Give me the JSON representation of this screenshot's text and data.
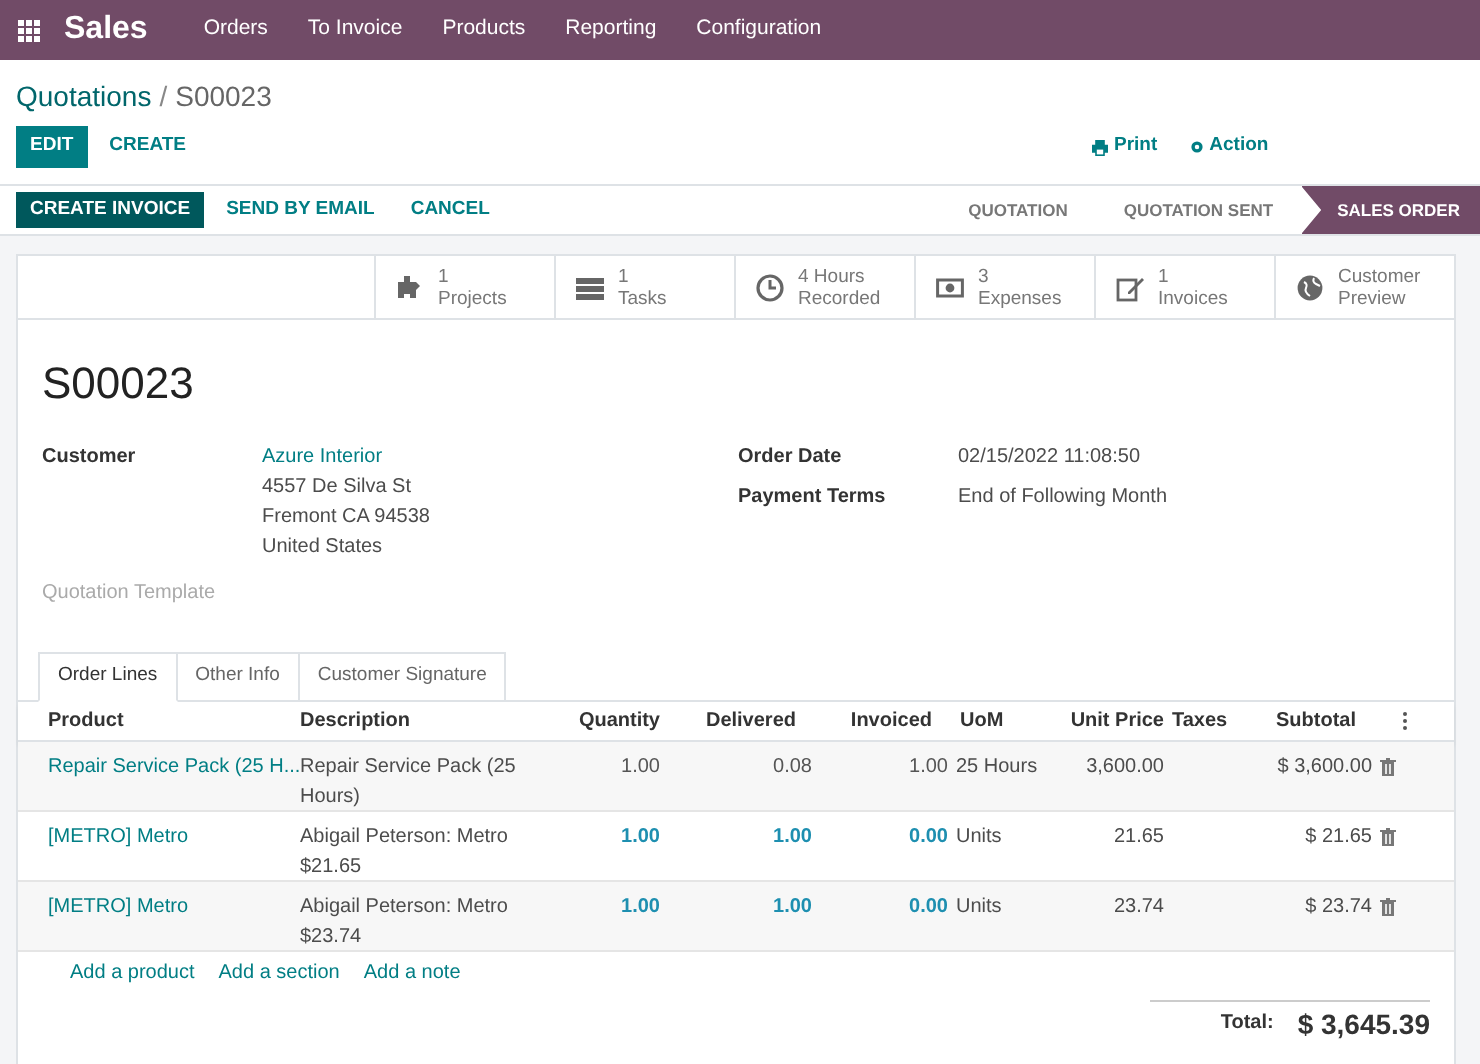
{
  "navbar": {
    "app": "Sales",
    "menu": [
      "Orders",
      "To Invoice",
      "Products",
      "Reporting",
      "Configuration"
    ]
  },
  "breadcrumb": {
    "parent": "Quotations",
    "separator": "/",
    "current": "S00023"
  },
  "control_buttons": [
    {
      "label": "EDIT",
      "primary": true
    },
    {
      "label": "CREATE",
      "primary": false
    }
  ],
  "actions": [
    {
      "kind": "print",
      "label": "Print"
    },
    {
      "kind": "action",
      "label": "Action"
    }
  ],
  "status_buttons": [
    {
      "label": "CREATE INVOICE",
      "primary": true
    },
    {
      "label": "SEND BY EMAIL",
      "primary": false
    },
    {
      "label": "CANCEL",
      "primary": false
    }
  ],
  "stages": [
    {
      "label": "QUOTATION",
      "selected": false
    },
    {
      "label": "QUOTATION SENT",
      "selected": false
    },
    {
      "label": "SALES ORDER",
      "selected": true
    }
  ],
  "smart_buttons": [
    {
      "kind": "projects",
      "value": "1",
      "label": "Projects"
    },
    {
      "kind": "tasks",
      "value": "1",
      "label": "Tasks"
    },
    {
      "kind": "hours",
      "value": "4 Hours",
      "label": "Recorded"
    },
    {
      "kind": "expenses",
      "value": "3",
      "label": "Expenses"
    },
    {
      "kind": "invoices",
      "value": "1",
      "label": "Invoices"
    },
    {
      "kind": "preview",
      "value": "Customer",
      "label": "Preview"
    }
  ],
  "title": "S00023",
  "customer": {
    "label": "Customer",
    "name": "Azure Interior",
    "address": [
      "4557 De Silva St",
      "Fremont CA 94538",
      "United States"
    ]
  },
  "order_info": [
    {
      "label": "Order Date",
      "value": "02/15/2022 11:08:50"
    },
    {
      "label": "Payment Terms",
      "value": "End of Following Month"
    }
  ],
  "quotation_template": {
    "label": "Quotation Template"
  },
  "tabs": [
    {
      "label": "Order Lines",
      "selected": true
    },
    {
      "label": "Other Info",
      "selected": false
    },
    {
      "label": "Customer Signature",
      "selected": false
    }
  ],
  "table": {
    "columns": [
      "Product",
      "Description",
      "Quantity",
      "Delivered",
      "Invoiced",
      "UoM",
      "Unit Price",
      "Taxes",
      "Subtotal"
    ],
    "rows": [
      {
        "kind": "service",
        "product": "Repair Service Pack (25 H...",
        "description": "Repair Service Pack (25 Hours)",
        "quantity": "1.00",
        "delivered": "0.08",
        "invoiced": "1.00",
        "uom": "25 Hours",
        "unit_price": "3,600.00",
        "subtotal": "$ 3,600.00"
      },
      {
        "kind": "expense",
        "product": "[METRO] Metro",
        "description": "Abigail Peterson: Metro $21.65",
        "quantity": "1.00",
        "delivered": "1.00",
        "invoiced": "0.00",
        "uom": "Units",
        "unit_price": "21.65",
        "subtotal": "$ 21.65"
      },
      {
        "kind": "expense",
        "product": "[METRO] Metro",
        "description": "Abigail Peterson: Metro $23.74",
        "quantity": "1.00",
        "delivered": "1.00",
        "invoiced": "0.00",
        "uom": "Units",
        "unit_price": "23.74",
        "subtotal": "$ 23.74"
      }
    ]
  },
  "add_links": [
    "Add a product",
    "Add a section",
    "Add a note"
  ],
  "total": {
    "label": "Total:",
    "value": "$ 3,645.39"
  }
}
